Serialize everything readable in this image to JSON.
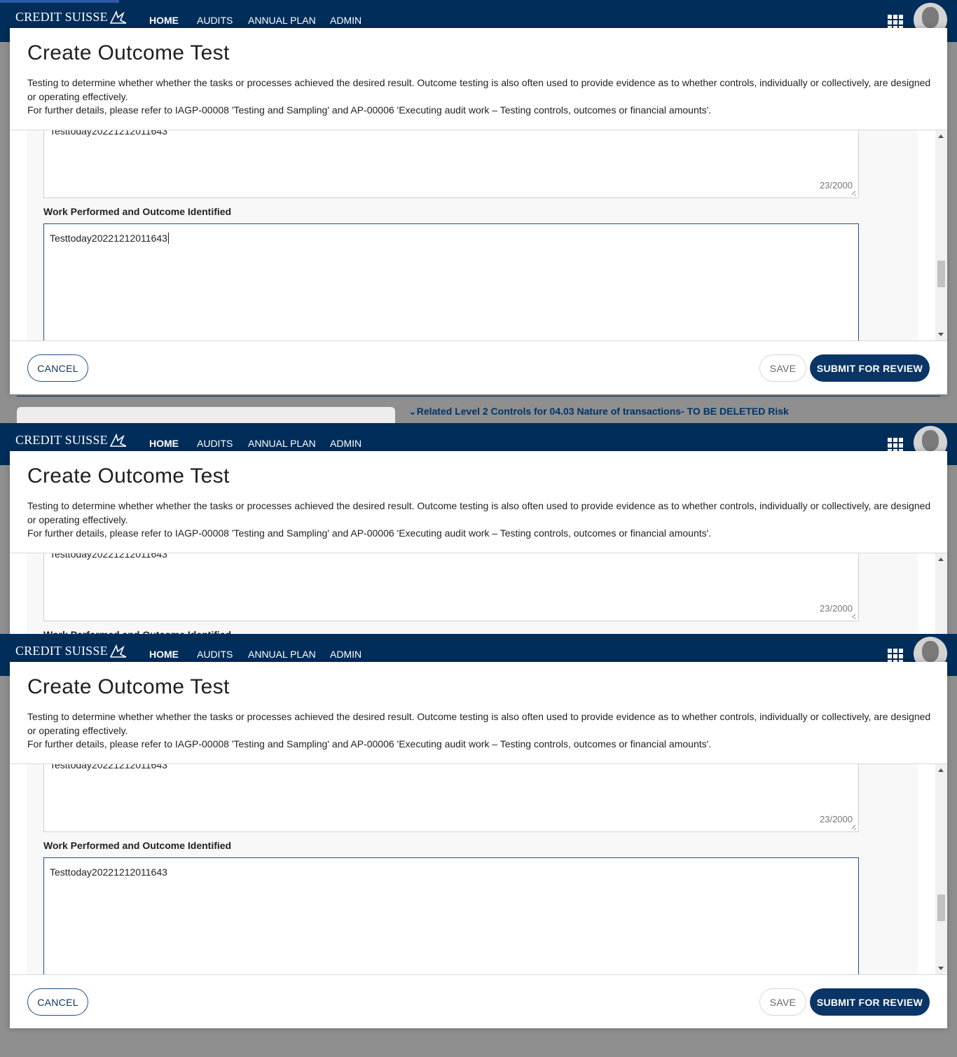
{
  "brand": {
    "name": "CREDIT SUISSE"
  },
  "nav": {
    "items": [
      {
        "label": "HOME",
        "active": true
      },
      {
        "label": "AUDITS",
        "active": false
      },
      {
        "label": "ANNUAL PLAN",
        "active": false
      },
      {
        "label": "ADMIN",
        "active": false
      }
    ]
  },
  "background": {
    "section_title": "Related Level 2 Controls for 04.03 Nature of transactions- TO BE DELETED Risk"
  },
  "modal": {
    "title": "Create Outcome Test",
    "description_line1": "Testing to determine whether whether the tasks or processes achieved the desired result. Outcome testing is also often used to provide evidence as to whether controls, individually or collectively, are designed or operating effectively.",
    "description_line2": "For further details, please refer to IAGP-00008 'Testing and Sampling' and AP-00006 'Executing audit work – Testing controls, outcomes or financial amounts'.",
    "previous_field": {
      "value": "Testtoday20221212011643",
      "counter": "23/2000"
    },
    "work_performed": {
      "label": "Work Performed and Outcome Identified",
      "value": "Testtoday20221212011643"
    },
    "buttons": {
      "cancel": "CANCEL",
      "save": "SAVE",
      "submit": "SUBMIT FOR REVIEW"
    }
  },
  "colors": {
    "nav_bg": "#002d5a",
    "primary": "#0b3566",
    "backdrop": "#8f8f8f"
  }
}
